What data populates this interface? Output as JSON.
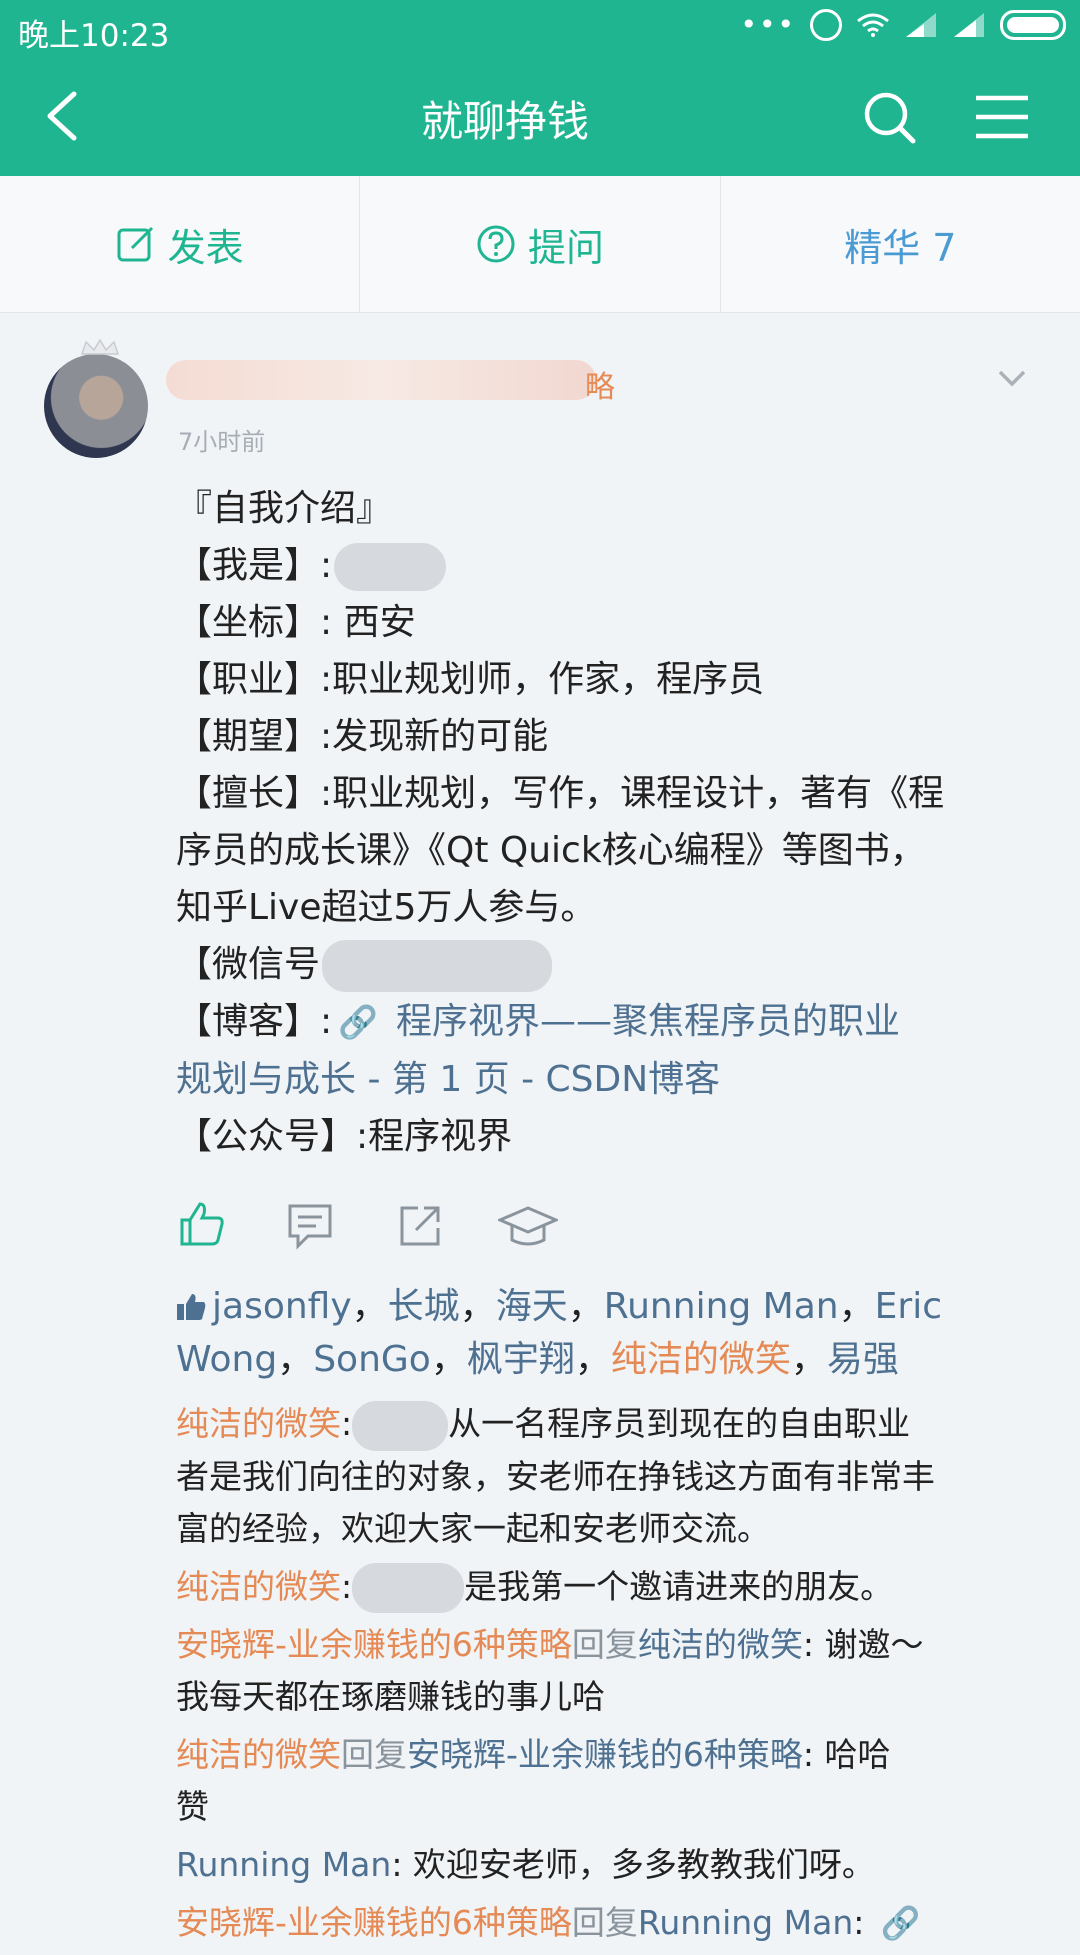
{
  "status_bar": {
    "time": "晚上10:23",
    "dots": "•••"
  },
  "nav": {
    "title": "就聊挣钱"
  },
  "tabs": [
    {
      "label": "发表",
      "icon": "edit-icon"
    },
    {
      "label": "提问",
      "icon": "question-icon"
    },
    {
      "label": "精华 7"
    }
  ],
  "post": {
    "author_tail": "略",
    "time": "7小时前",
    "lines": {
      "l1": "『自我介绍』",
      "l2": "【我是】:",
      "l3": "【坐标】:  西安",
      "l4": "【职业】:职业规划师，作家，程序员",
      "l5": "【期望】:发现新的可能",
      "l6": "【擅长】:职业规划，写作，课程设计，著有《程",
      "l7": "序员的成长课》《Qt Quick核心编程》等图书，",
      "l8": "知乎Live超过5万人参与。",
      "l9": "【微信号",
      "l10_prefix": "【博客】:",
      "l10_link": "程序视界——聚焦程序员的职业",
      "l11_link": "规划与成长 - 第 1 页 - CSDN博客",
      "l12": "【公众号】:程序视界"
    }
  },
  "likes": {
    "names": [
      "jasonfly",
      "长城",
      "海天",
      "Running Man",
      "Eric Wong",
      "SonGo",
      "枫宇翔",
      "纯洁的微笑",
      "易强"
    ]
  },
  "comments": {
    "c1_user": "纯洁的微笑",
    "c1_a": ":",
    "c1_b": "从一名程序员到现在的自由职业",
    "c1_c": "者是我们向往的对象，安老师在挣钱这方面有非常丰",
    "c1_d": "富的经验，欢迎大家一起和安老师交流。",
    "c2_user": "纯洁的微笑",
    "c2_a": ":",
    "c2_b": "是我第一个邀请进来的朋友。",
    "c3_user": "安晓辉-业余赚钱的6种策略",
    "c3_reply": "回复",
    "c3_target": "纯洁的微笑",
    "c3_text": ": 谢邀～",
    "c3_text2": "我每天都在琢磨赚钱的事儿哈",
    "c4_user": "纯洁的微笑",
    "c4_reply": "回复",
    "c4_target": "安晓辉-业余赚钱的6种策略",
    "c4_text": ": 哈哈",
    "c4_text2": "赞",
    "c5_user": "Running Man",
    "c5_text": ": 欢迎安老师，多多教教我们呀。",
    "c6_user": "安晓辉-业余赚钱的6种策略",
    "c6_reply": "回复",
    "c6_target": "Running Man",
    "c6_text": ":"
  },
  "colors": {
    "accent": "#1fb591",
    "link": "#4e7191",
    "username": "#e58a55"
  }
}
